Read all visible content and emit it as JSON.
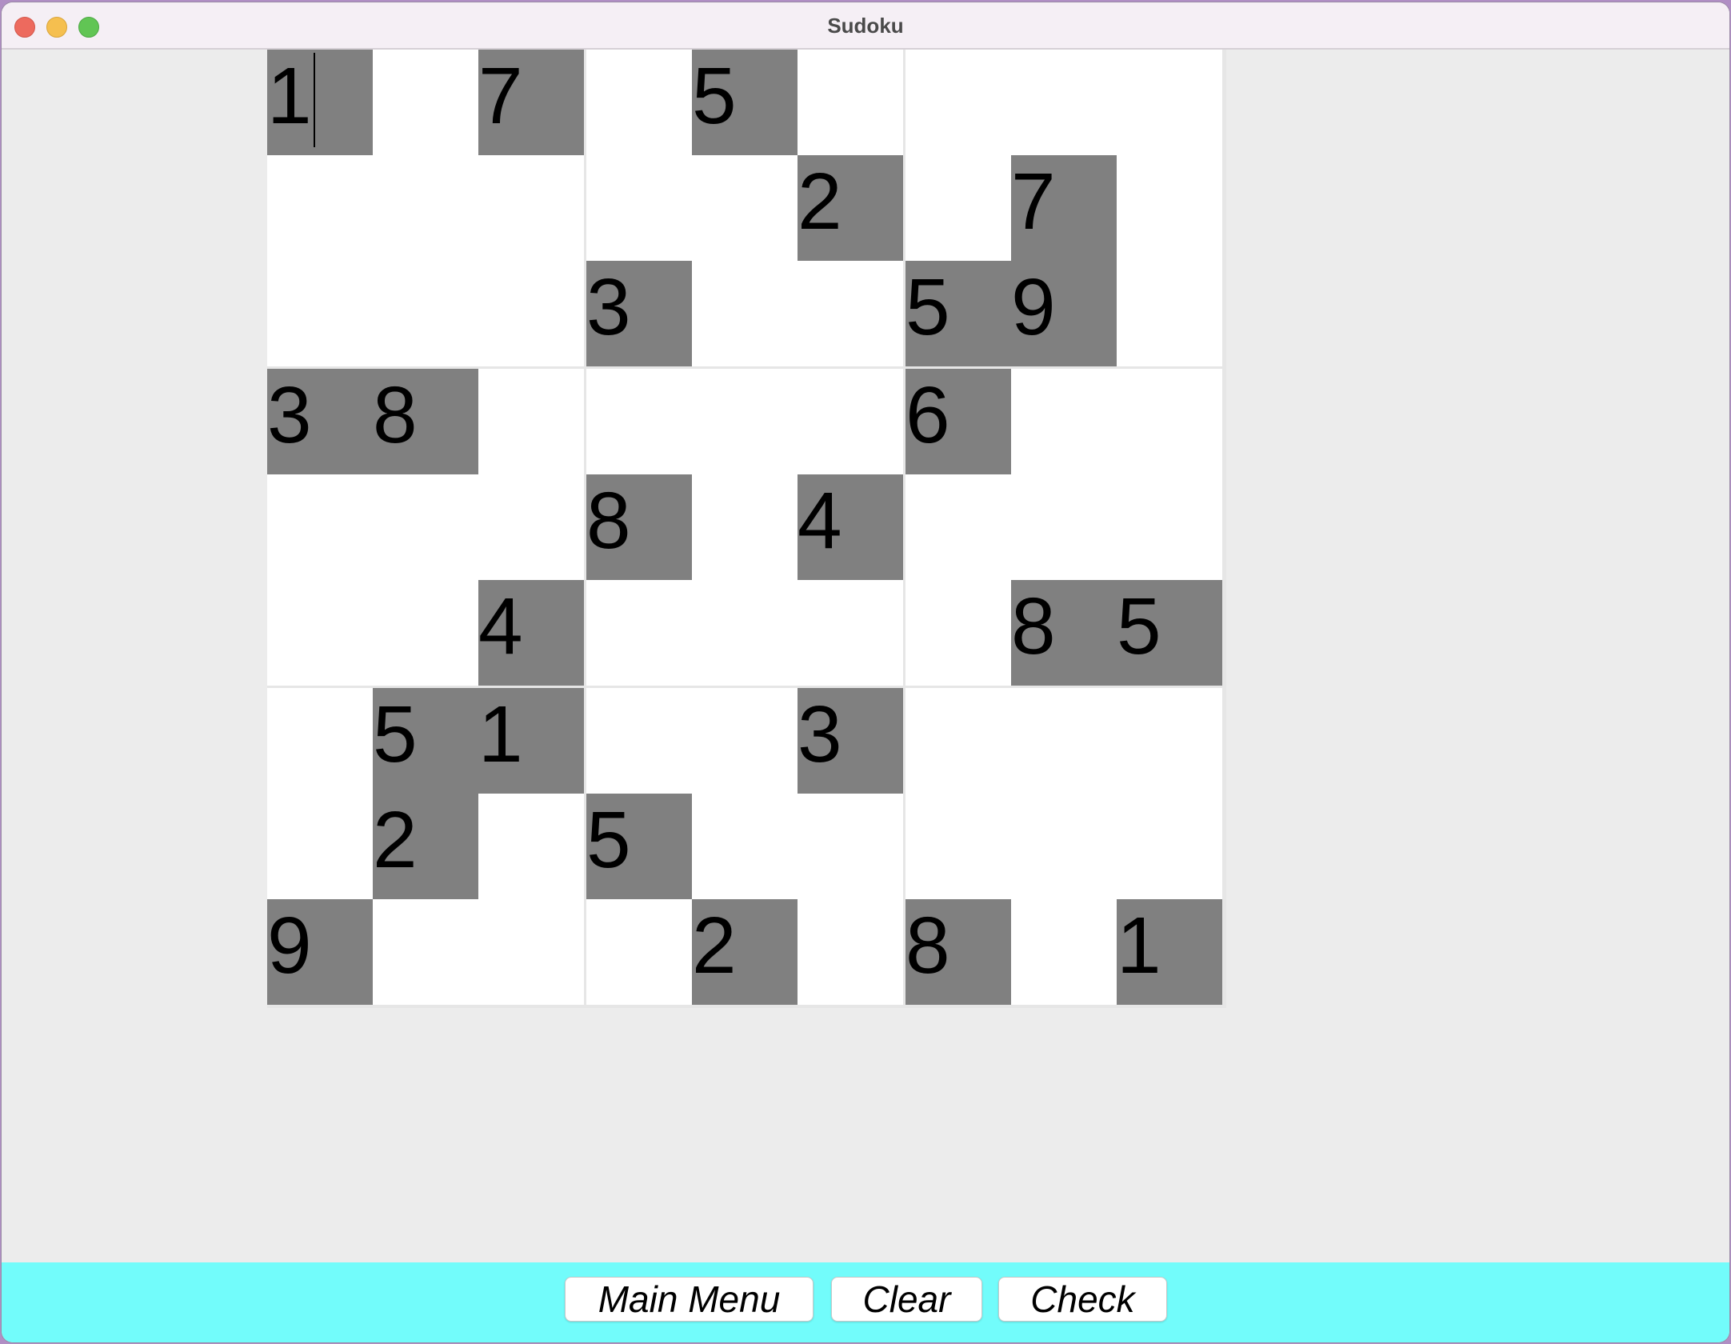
{
  "window": {
    "title": "Sudoku"
  },
  "board": {
    "rows": [
      [
        "1",
        "",
        "7",
        "",
        "5",
        "",
        "",
        "",
        ""
      ],
      [
        "",
        "",
        "",
        "",
        "",
        "2",
        "",
        "7",
        ""
      ],
      [
        "",
        "",
        "",
        "3",
        "",
        "",
        "5",
        "9",
        ""
      ],
      [
        "3",
        "8",
        "",
        "",
        "",
        "",
        "6",
        "",
        ""
      ],
      [
        "",
        "",
        "",
        "8",
        "",
        "4",
        "",
        "",
        ""
      ],
      [
        "",
        "",
        "4",
        "",
        "",
        "",
        "",
        "8",
        "5"
      ],
      [
        "",
        "5",
        "1",
        "",
        "",
        "3",
        "",
        "",
        ""
      ],
      [
        "",
        "2",
        "",
        "5",
        "",
        "",
        "",
        "",
        ""
      ],
      [
        "9",
        "",
        "",
        "",
        "2",
        "",
        "8",
        "",
        "1"
      ]
    ],
    "given": [
      [
        1,
        0,
        1,
        0,
        1,
        0,
        0,
        0,
        0
      ],
      [
        0,
        0,
        0,
        0,
        0,
        1,
        0,
        1,
        0
      ],
      [
        0,
        0,
        0,
        1,
        0,
        0,
        1,
        1,
        0
      ],
      [
        1,
        1,
        0,
        0,
        0,
        0,
        1,
        0,
        0
      ],
      [
        0,
        0,
        0,
        1,
        0,
        1,
        0,
        0,
        0
      ],
      [
        0,
        0,
        1,
        0,
        0,
        0,
        0,
        1,
        1
      ],
      [
        0,
        1,
        1,
        0,
        0,
        1,
        0,
        0,
        0
      ],
      [
        0,
        1,
        0,
        1,
        0,
        0,
        0,
        0,
        0
      ],
      [
        1,
        0,
        0,
        0,
        1,
        0,
        1,
        0,
        1
      ]
    ],
    "given_color": "#808080",
    "empty_color": "#ffffff",
    "focused_cell": {
      "row": 0,
      "col": 0
    }
  },
  "buttons": {
    "main_menu": "Main Menu",
    "clear": "Clear",
    "check": "Check"
  },
  "colors": {
    "bottom_bar": "#72fcfb"
  }
}
